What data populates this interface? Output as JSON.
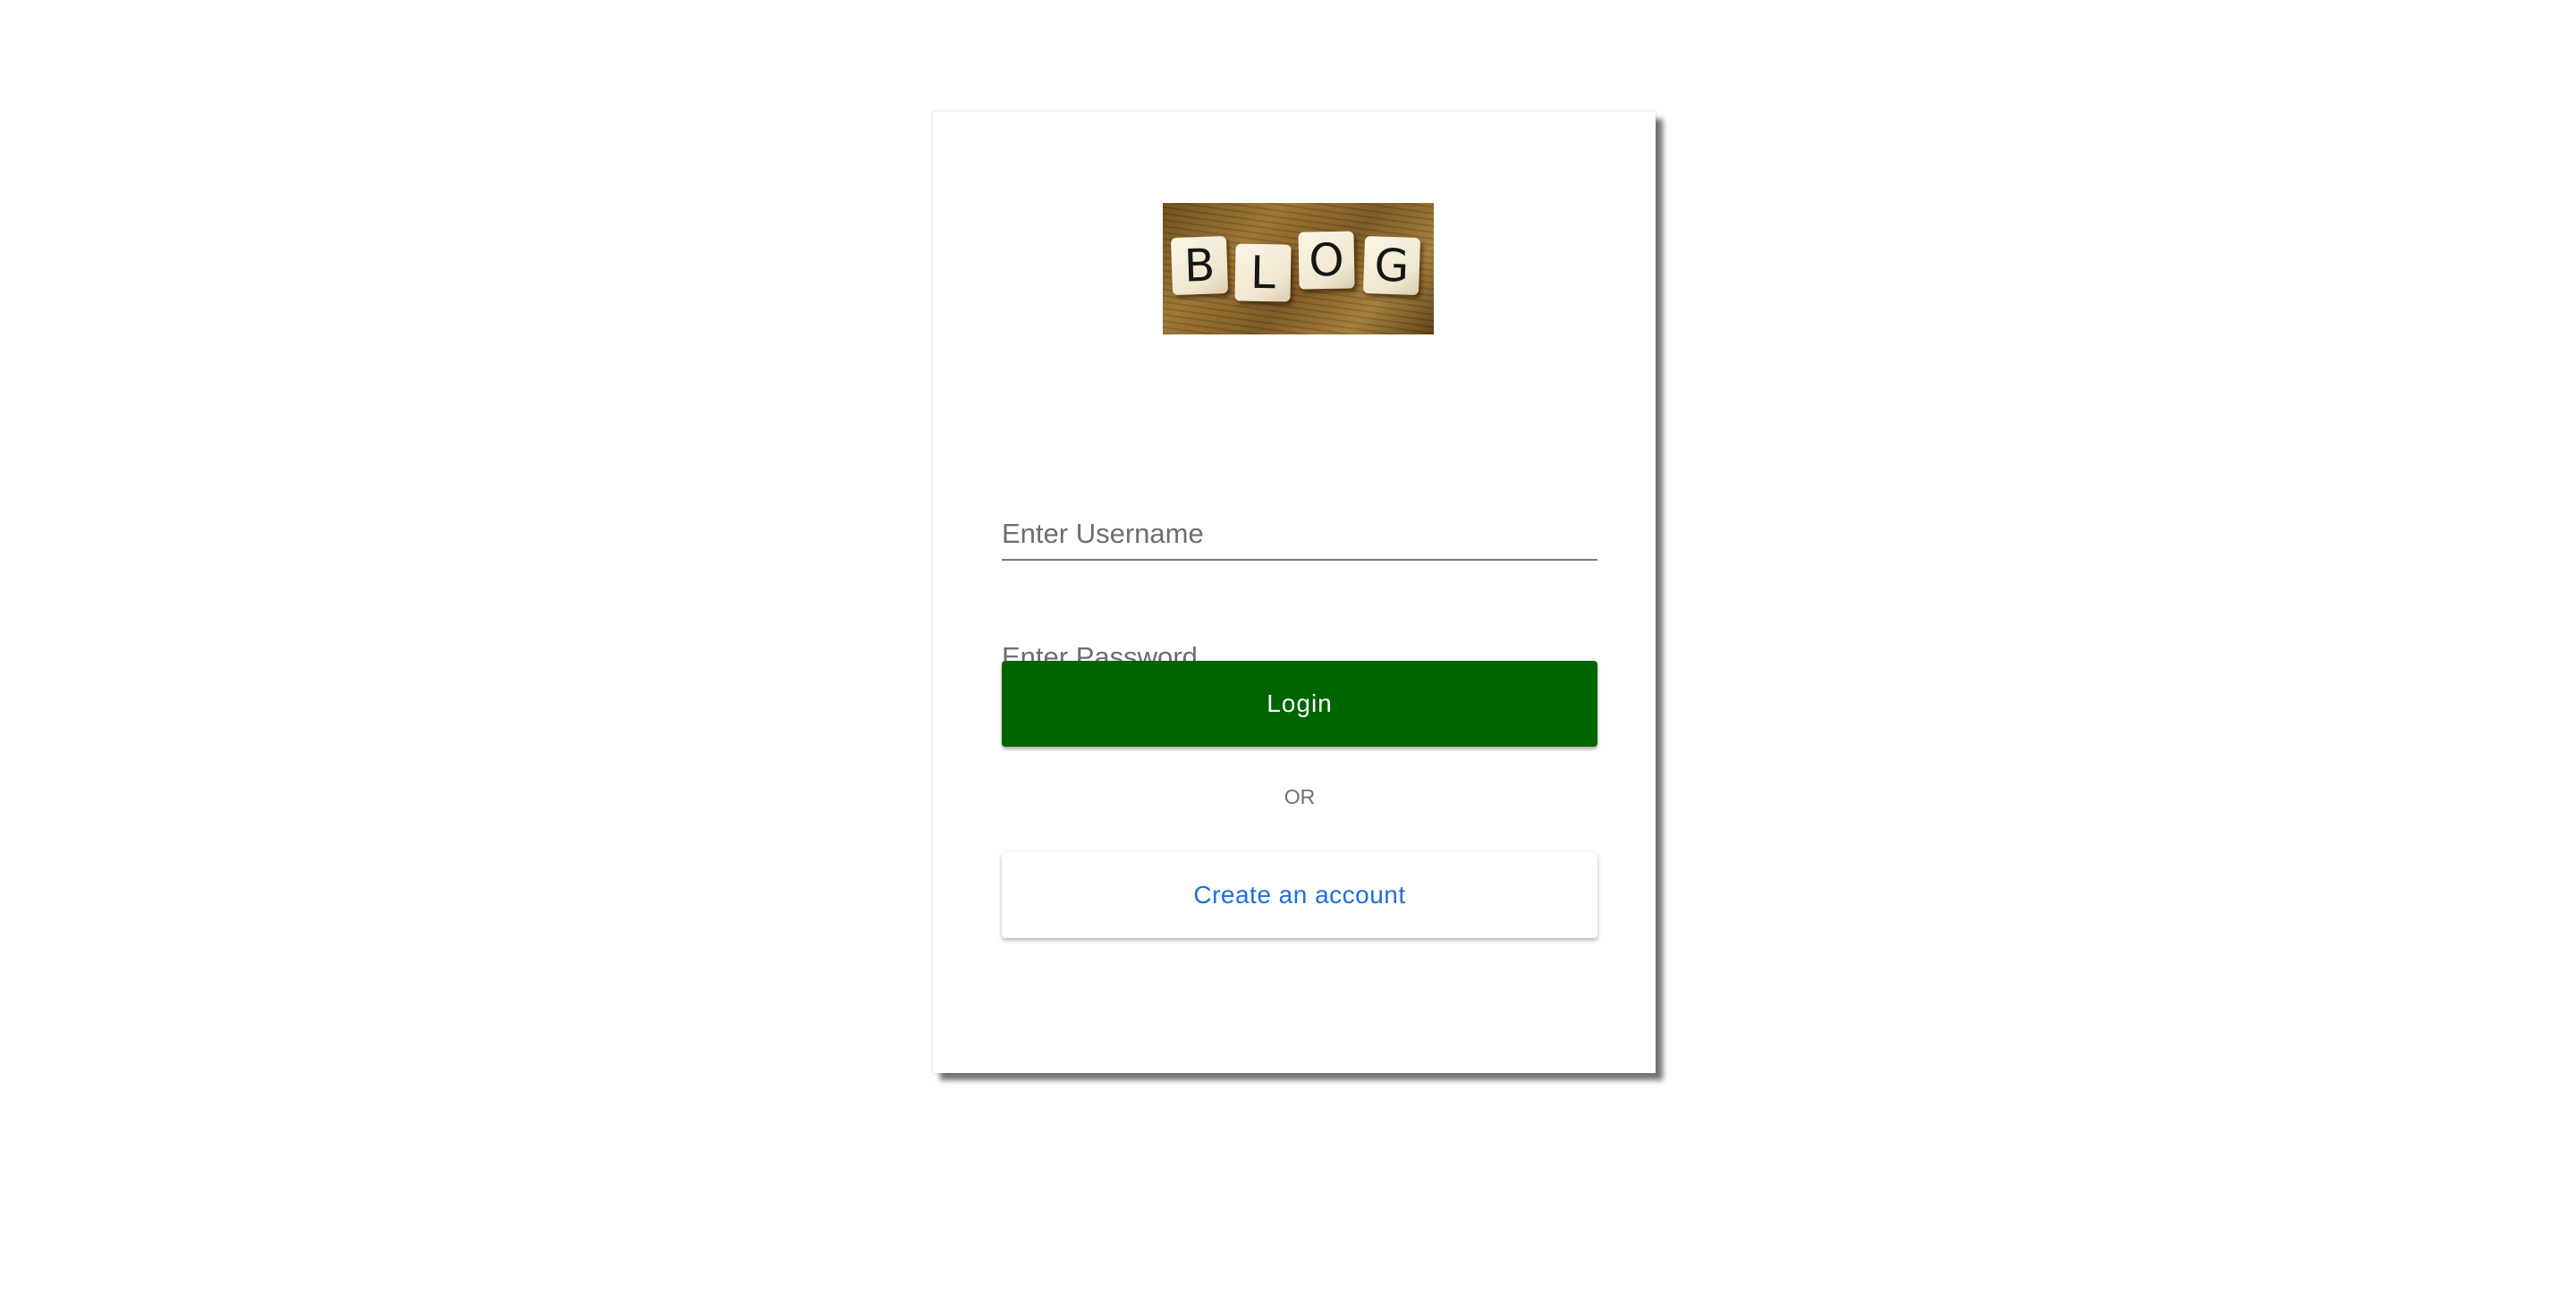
{
  "logo": {
    "tiles": [
      "B",
      "L",
      "O",
      "G"
    ]
  },
  "form": {
    "username_placeholder": "Enter Username",
    "username_value": "",
    "password_placeholder": "Enter Password",
    "password_value": "",
    "login_label": "Login",
    "separator_label": "OR",
    "create_account_label": "Create an account"
  },
  "colors": {
    "login_button": "#006400",
    "link_text": "#1e6fe0",
    "placeholder_text": "#6e6e6e"
  }
}
